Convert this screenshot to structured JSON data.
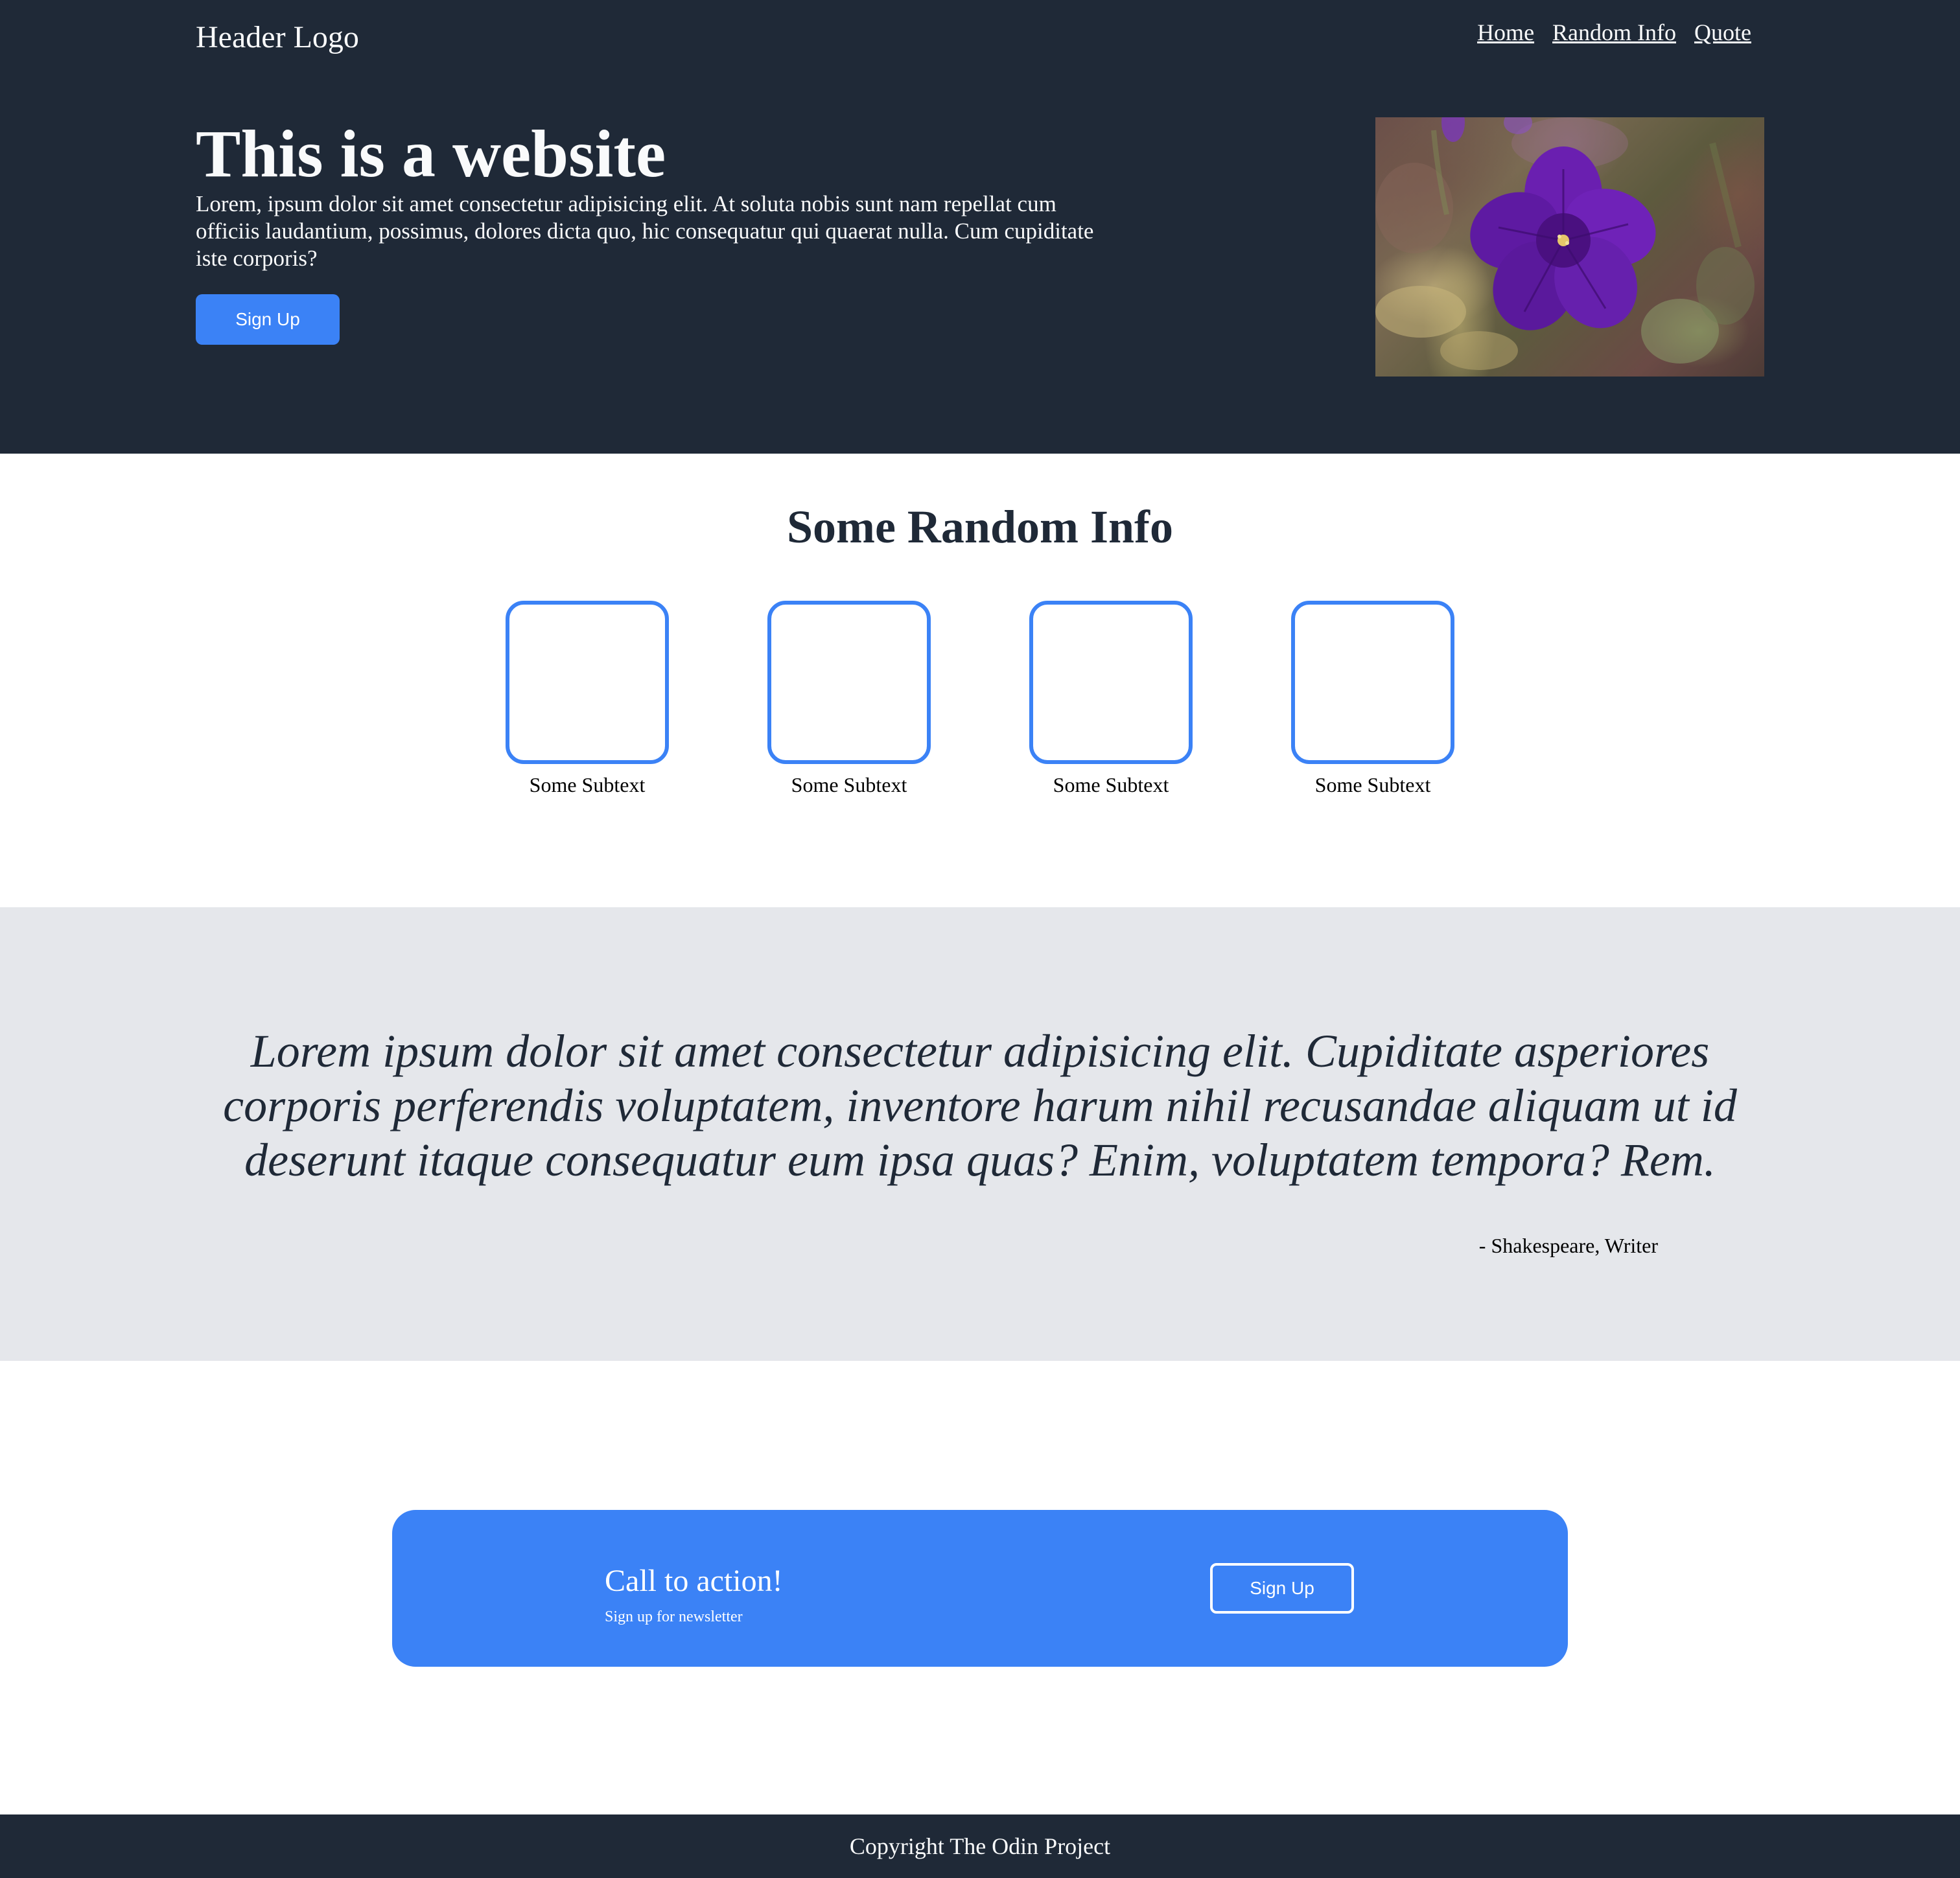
{
  "header": {
    "logo": "Header Logo",
    "nav": [
      "Home",
      "Random Info",
      "Quote"
    ]
  },
  "hero": {
    "title": "This is a website",
    "text": "Lorem, ipsum dolor sit amet consectetur adipisicing elit. At soluta nobis sunt nam repellat cum officiis laudantium, possimus, dolores dicta quo, hic consequatur qui quaerat nulla. Cum cupiditate iste corporis?",
    "button_label": "Sign Up",
    "image_icon": "purple-flower-photo"
  },
  "info": {
    "title": "Some Random Info",
    "cards": [
      {
        "subtext": "Some Subtext"
      },
      {
        "subtext": "Some Subtext"
      },
      {
        "subtext": "Some Subtext"
      },
      {
        "subtext": "Some Subtext"
      }
    ]
  },
  "quote": {
    "text": "Lorem ipsum dolor sit amet consectetur adipisicing elit. Cupiditate asperiores corporis perferendis voluptatem, inventore harum nihil recusandae aliquam ut id deserunt itaque consequatur eum ipsa quas? Enim, voluptatem tempora? Rem.",
    "author": "- Shakespeare, Writer"
  },
  "cta": {
    "title": "Call to action!",
    "subtitle": "Sign up for newsletter",
    "button_label": "Sign Up"
  },
  "footer": {
    "text": "Copyright The Odin Project"
  },
  "colors": {
    "dark": "#1f2937",
    "accent": "#3b82f6",
    "light_gray": "#e5e7eb",
    "white": "#ffffff"
  }
}
